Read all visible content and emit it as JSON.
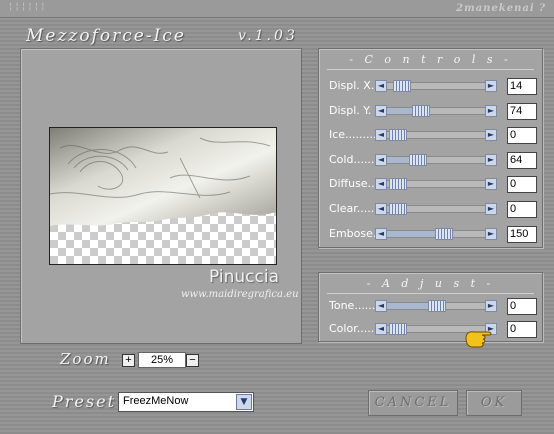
{
  "window": {
    "grip": "¦¦¦¦¦¦",
    "top_right_text": "2manekenai ?",
    "plugin_title": "Mezzoforce-Ice",
    "version": "v.1.03"
  },
  "preview": {
    "watermark_name": "Pinuccia",
    "watermark_url": "www.maidiregrafica.eu"
  },
  "controls": {
    "title": "- C o n t r o l s -",
    "rows": [
      {
        "label": "Displ. X.",
        "value": "14",
        "level": 0.055
      },
      {
        "label": "Displ. Y.",
        "value": "74",
        "level": 0.29
      },
      {
        "label": "Ice.........",
        "value": "0",
        "level": 0
      },
      {
        "label": "Cold.......",
        "value": "64",
        "level": 0.25
      },
      {
        "label": "Diffuse....",
        "value": "0",
        "level": 0
      },
      {
        "label": "Clear......",
        "value": "0",
        "level": 0
      },
      {
        "label": "Embose.",
        "value": "150",
        "level": 0.59
      }
    ]
  },
  "adjust": {
    "title": "- A d j u s t -",
    "rows": [
      {
        "label": "Tone.......",
        "value": "0",
        "level": 0.5
      },
      {
        "label": "Color......",
        "value": "0",
        "level": 0
      }
    ]
  },
  "zoom": {
    "label": "Zoom",
    "minus": "−",
    "plus": "+",
    "value": "25%"
  },
  "preset": {
    "label": "Preset",
    "value": "FreezMeNow",
    "dropdown_icon": "▼"
  },
  "buttons": {
    "cancel": "CANCEL",
    "ok": "OK"
  },
  "colors": {
    "panel_bg": "#a3a3a3",
    "slider_accent": "#a9b8cf",
    "pointer": "#f0c020"
  }
}
